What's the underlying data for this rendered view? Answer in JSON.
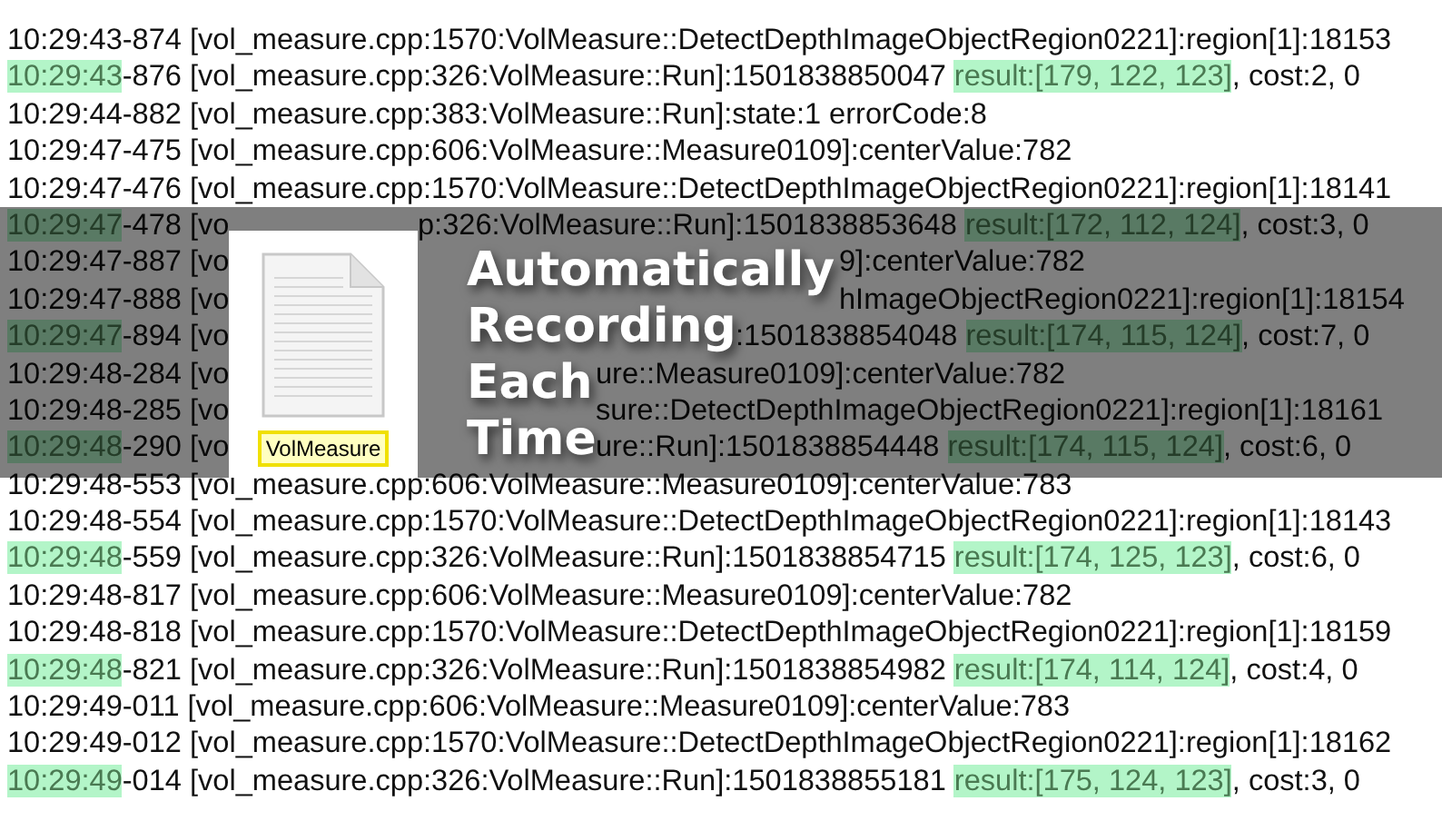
{
  "log_lines": [
    {
      "kind": "full",
      "segments": [
        {
          "text": "10:29:43-874 [vol_measure.cpp:1570:VolMeasure::DetectDepthImageObjectRegion0221]:region[1]:18153",
          "highlighted": false
        }
      ]
    },
    {
      "kind": "full",
      "segments": [
        {
          "text": "10:29:43",
          "highlighted": true
        },
        {
          "text": "-876 [vol_measure.cpp:326:VolMeasure::Run]:1501838850047 ",
          "highlighted": false
        },
        {
          "text": "result:[179, 122, 123]",
          "highlighted": true
        },
        {
          "text": ", cost:2, 0",
          "highlighted": false
        }
      ]
    },
    {
      "kind": "full",
      "segments": [
        {
          "text": "10:29:44-882 [vol_measure.cpp:383:VolMeasure::Run]:state:1 errorCode:8",
          "highlighted": false
        }
      ]
    },
    {
      "kind": "full",
      "segments": [
        {
          "text": "10:29:47-475 [vol_measure.cpp:606:VolMeasure::Measure0109]:centerValue:782",
          "highlighted": false
        }
      ]
    },
    {
      "kind": "full",
      "segments": [
        {
          "text": "10:29:47-476 [vol_measure.cpp:1570:VolMeasure::DetectDepthImageObjectRegion0221]:region[1]:18141",
          "highlighted": false
        }
      ]
    },
    {
      "kind": "under_card",
      "segments": [
        {
          "text": "10:29:47",
          "highlighted": true
        },
        {
          "text": "-478 [vo",
          "highlighted": false
        }
      ],
      "segments_after": [
        {
          "text": "p:326:VolMeasure::Run]:1501838853648 ",
          "highlighted": false
        },
        {
          "text": "result:[172, 112, 124]",
          "highlighted": true
        },
        {
          "text": ", cost:3, 0",
          "highlighted": false
        }
      ]
    },
    {
      "kind": "under_long_heading",
      "segments": [
        {
          "text": "10:29:47-887 [vo",
          "highlighted": false
        }
      ],
      "segments_after": [
        {
          "text": "9]:centerValue:782",
          "highlighted": false
        }
      ]
    },
    {
      "kind": "under_long_heading",
      "segments": [
        {
          "text": "10:29:47-888 [vo",
          "highlighted": false
        }
      ],
      "segments_after": [
        {
          "text": "hImageObjectRegion0221]:region[1]:18154",
          "highlighted": false
        }
      ]
    },
    {
      "kind": "under_mid_heading",
      "segments": [
        {
          "text": "10:29:47",
          "highlighted": true
        },
        {
          "text": "-894 [vo",
          "highlighted": false
        }
      ],
      "segments_after": [
        {
          "text": ":1501838854048 ",
          "highlighted": false
        },
        {
          "text": "result:[174, 115, 124]",
          "highlighted": true
        },
        {
          "text": ", cost:7, 0",
          "highlighted": false
        }
      ]
    },
    {
      "kind": "under_short_heading",
      "segments": [
        {
          "text": "10:29:48-284 [vo",
          "highlighted": false
        }
      ],
      "segments_after": [
        {
          "text": "ure::Measure0109]:centerValue:782",
          "highlighted": false
        }
      ]
    },
    {
      "kind": "under_short_heading",
      "segments": [
        {
          "text": "10:29:48-285 [vo",
          "highlighted": false
        }
      ],
      "segments_after": [
        {
          "text": "sure::DetectDepthImageObjectRegion0221]:region[1]:18161",
          "highlighted": false
        }
      ]
    },
    {
      "kind": "under_short_heading",
      "segments": [
        {
          "text": "10:29:48",
          "highlighted": true
        },
        {
          "text": "-290 [vo",
          "highlighted": false
        }
      ],
      "segments_after": [
        {
          "text": "ure::Run]:1501838854448 ",
          "highlighted": false
        },
        {
          "text": "result:[174, 115, 124]",
          "highlighted": true
        },
        {
          "text": ", cost:6, 0",
          "highlighted": false
        }
      ]
    },
    {
      "kind": "full",
      "segments": [
        {
          "text": "10:29:48-553 [vol_measure.cpp:606:VolMeasure::Measure0109]:centerValue:783",
          "highlighted": false
        }
      ]
    },
    {
      "kind": "full",
      "segments": [
        {
          "text": "10:29:48-554 [vol_measure.cpp:1570:VolMeasure::DetectDepthImageObjectRegion0221]:region[1]:18143",
          "highlighted": false
        }
      ]
    },
    {
      "kind": "full",
      "segments": [
        {
          "text": "10:29:48",
          "highlighted": true
        },
        {
          "text": "-559 [vol_measure.cpp:326:VolMeasure::Run]:1501838854715 ",
          "highlighted": false
        },
        {
          "text": "result:[174, 125, 123]",
          "highlighted": true
        },
        {
          "text": ", cost:6, 0",
          "highlighted": false
        }
      ]
    },
    {
      "kind": "full",
      "segments": [
        {
          "text": "10:29:48-817 [vol_measure.cpp:606:VolMeasure::Measure0109]:centerValue:782",
          "highlighted": false
        }
      ]
    },
    {
      "kind": "full",
      "segments": [
        {
          "text": "10:29:48-818 [vol_measure.cpp:1570:VolMeasure::DetectDepthImageObjectRegion0221]:region[1]:18159",
          "highlighted": false
        }
      ]
    },
    {
      "kind": "full",
      "segments": [
        {
          "text": "10:29:48",
          "highlighted": true
        },
        {
          "text": "-821 [vol_measure.cpp:326:VolMeasure::Run]:1501838854982 ",
          "highlighted": false
        },
        {
          "text": "result:[174, 114, 124]",
          "highlighted": true
        },
        {
          "text": ", cost:4, 0",
          "highlighted": false
        }
      ]
    },
    {
      "kind": "full",
      "segments": [
        {
          "text": "10:29:49-011 [vol_measure.cpp:606:VolMeasure::Measure0109]:centerValue:783",
          "highlighted": false
        }
      ]
    },
    {
      "kind": "full",
      "segments": [
        {
          "text": "10:29:49-012 [vol_measure.cpp:1570:VolMeasure::DetectDepthImageObjectRegion0221]:region[1]:18162",
          "highlighted": false
        }
      ]
    },
    {
      "kind": "full",
      "segments": [
        {
          "text": "10:29:49",
          "highlighted": true
        },
        {
          "text": "-014 [vol_measure.cpp:326:VolMeasure::Run]:1501838855181 ",
          "highlighted": false
        },
        {
          "text": "result:[175, 124, 123]",
          "highlighted": true
        },
        {
          "text": ", cost:3, 0",
          "highlighted": false
        }
      ]
    }
  ],
  "banner": {
    "file_name": "VolMeasure",
    "caption_lines": [
      "Automatically",
      "Recording",
      "Each",
      "Time"
    ]
  }
}
